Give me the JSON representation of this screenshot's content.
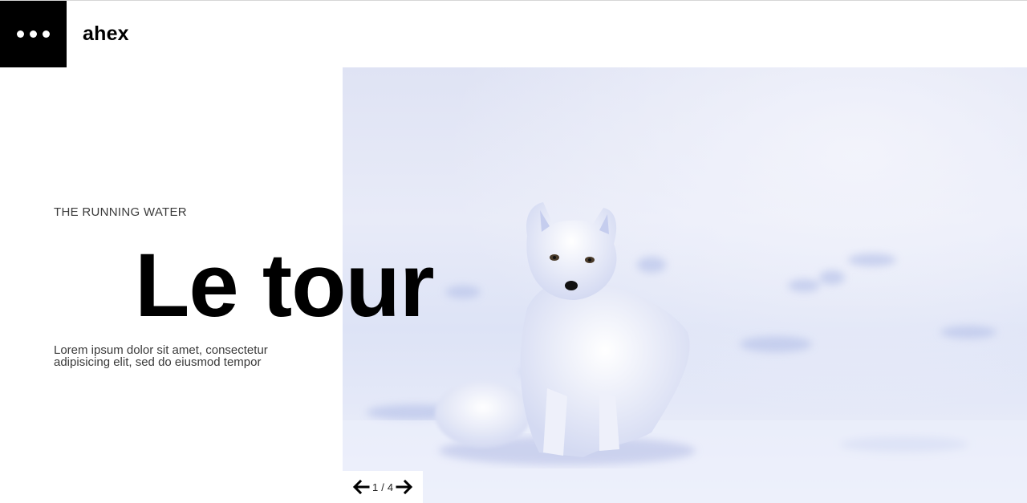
{
  "header": {
    "logo_text": "ahex",
    "menu_icon": "more-dots-icon"
  },
  "hero": {
    "eyebrow": "THE RUNNING WATER",
    "headline": "Le tour",
    "description": "Lorem ipsum dolor sit amet, consectetur adipisicing elit, sed do eiusmod tempor",
    "image_subject": "arctic fox sitting in snow"
  },
  "slider": {
    "current": "1",
    "separator": "/",
    "total": "4",
    "prev_icon": "arrow-left-icon",
    "next_icon": "arrow-right-icon"
  },
  "colors": {
    "menu_background": "#000000",
    "snow_light": "#eef0fa",
    "snow_blue": "#c9d2f0"
  }
}
